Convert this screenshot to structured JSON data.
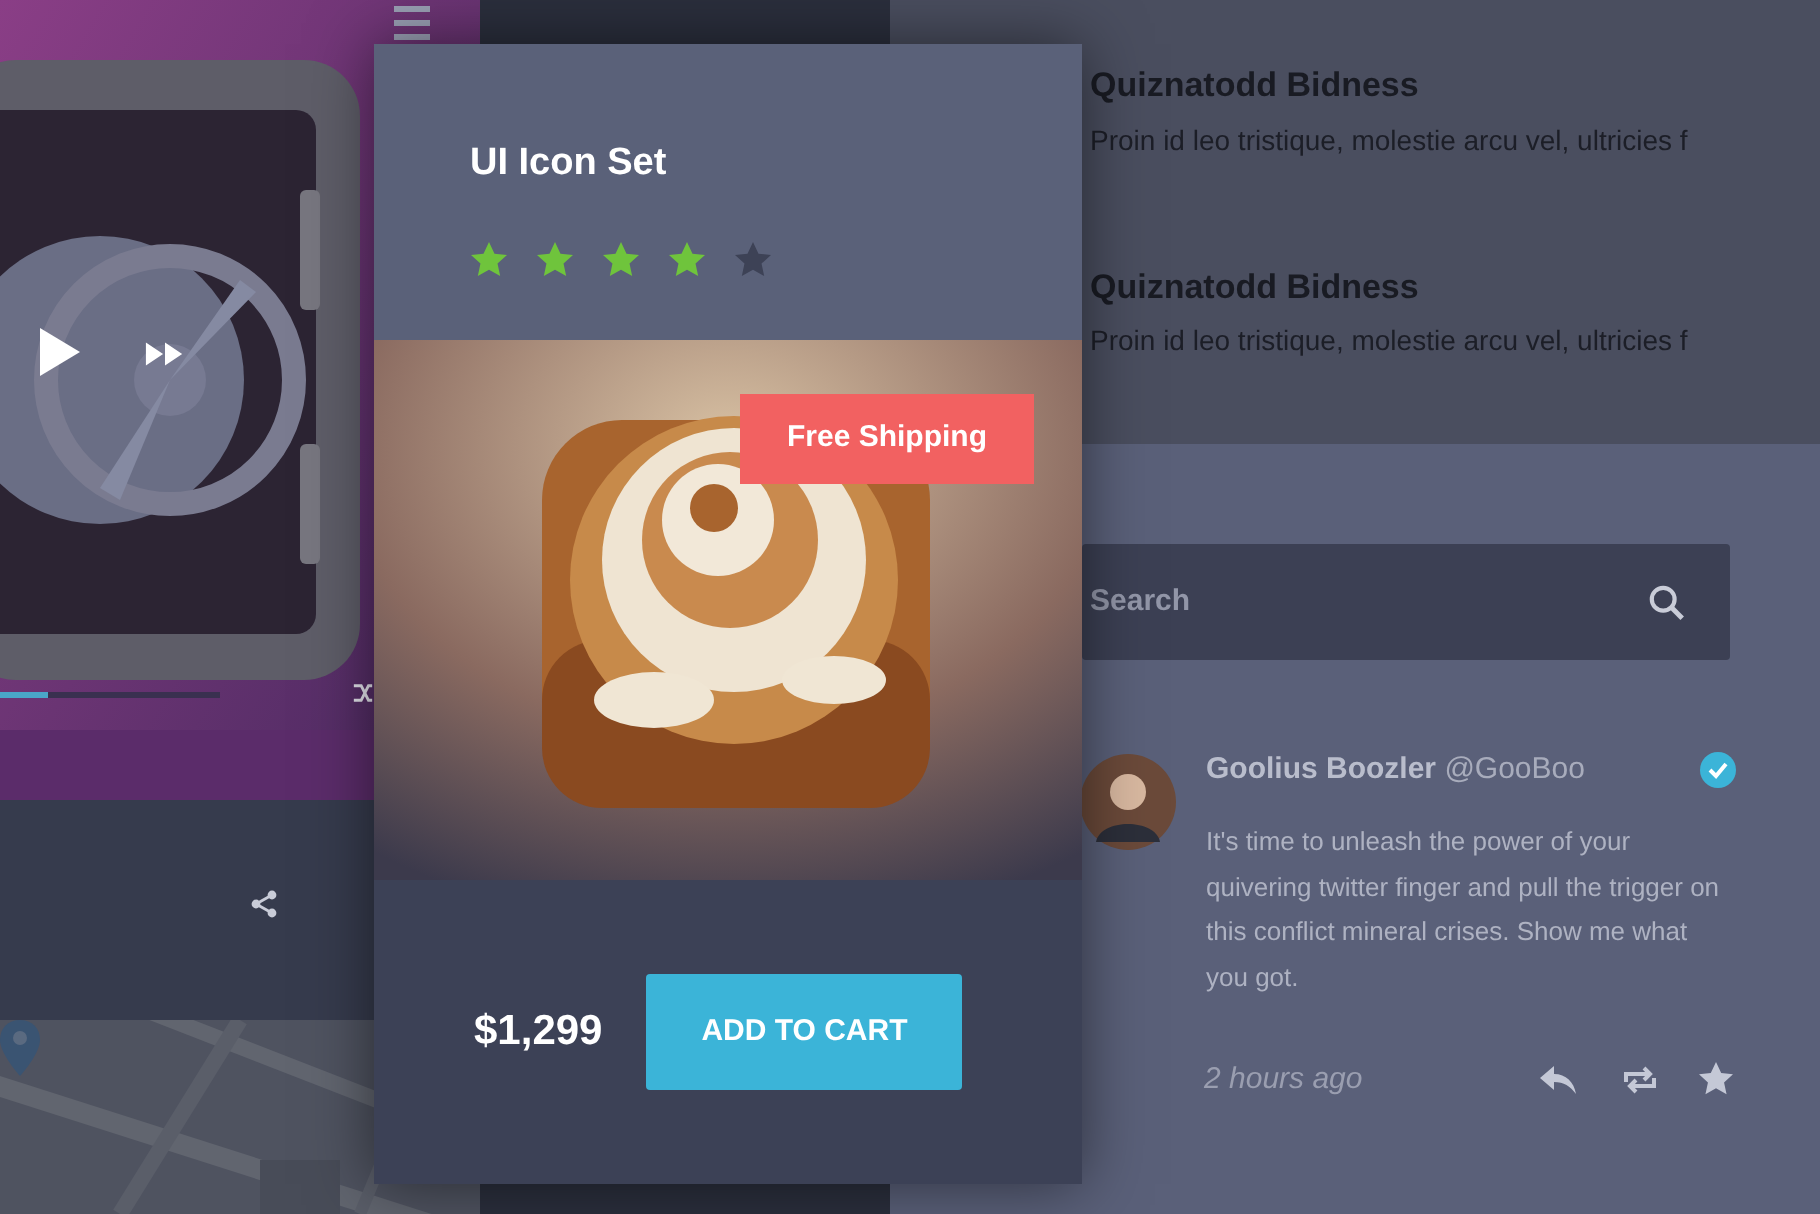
{
  "player": {
    "kind": "picture",
    "progress": {
      "level": 0.22
    }
  },
  "list_items": [
    {
      "title": "Quiznatodd Bidness",
      "text": "Proin id leo tristique, molestie arcu vel, ultricies f"
    },
    {
      "title": "Quiznatodd Bidness",
      "text": "Proin id leo tristique, molestie arcu vel, ultricies f"
    }
  ],
  "product": {
    "title": "UI Icon Set",
    "stars": 4,
    "badge": "Free Shipping",
    "price": "$1,299",
    "button": "ADD TO CART"
  },
  "search": {
    "placeholder": "Search"
  },
  "tweet": {
    "name": "Goolius Boozler",
    "handle": "@GooBoo",
    "verified": true,
    "text": "It's time to unleash the power of your quivering twitter finger and pull the trigger on this conflict mineral crises. Show me what you got.",
    "time": "2 hours ago"
  }
}
